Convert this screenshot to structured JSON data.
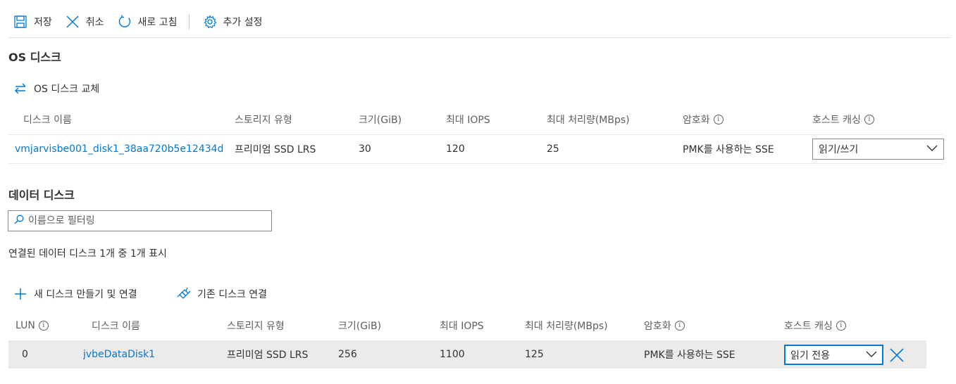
{
  "toolbar": {
    "save": "저장",
    "cancel": "취소",
    "refresh": "새로 고침",
    "settings": "추가 설정"
  },
  "os_disk": {
    "title": "OS 디스크",
    "swap_label": "OS 디스크 교체",
    "headers": {
      "name": "디스크 이름",
      "storage": "스토리지 유형",
      "size": "크기(GiB)",
      "iops": "최대 IOPS",
      "throughput": "최대 처리량(MBps)",
      "encryption": "암호화",
      "caching": "호스트 캐싱"
    },
    "row": {
      "name": "vmjarvisbe001_disk1_38aa720b5e12434d",
      "storage": "프리미엄 SSD LRS",
      "size": "30",
      "iops": "120",
      "throughput": "25",
      "encryption": "PMK를 사용하는 SSE",
      "caching": "읽기/쓰기"
    }
  },
  "data_disks": {
    "title": "데이터 디스크",
    "filter_placeholder": "이름으로 필터링",
    "count_text": "연결된 데이터 디스크 1개 중 1개 표시",
    "create_label": "새 디스크 만들기 및 연결",
    "attach_label": "기존 디스크 연결",
    "headers": {
      "lun": "LUN",
      "name": "디스크 이름",
      "storage": "스토리지 유형",
      "size": "크기(GiB)",
      "iops": "최대 IOPS",
      "throughput": "최대 처리량(MBps)",
      "encryption": "암호화",
      "caching": "호스트 캐싱"
    },
    "row": {
      "lun": "0",
      "name": "jvbeDataDisk1",
      "storage": "프리미엄 SSD LRS",
      "size": "256",
      "iops": "1100",
      "throughput": "125",
      "encryption": "PMK를 사용하는 SSE",
      "caching": "읽기 전용"
    }
  },
  "colors": {
    "accent": "#0078d4",
    "text": "#323130",
    "muted": "#605e5c",
    "row_selected": "#edebe9"
  }
}
